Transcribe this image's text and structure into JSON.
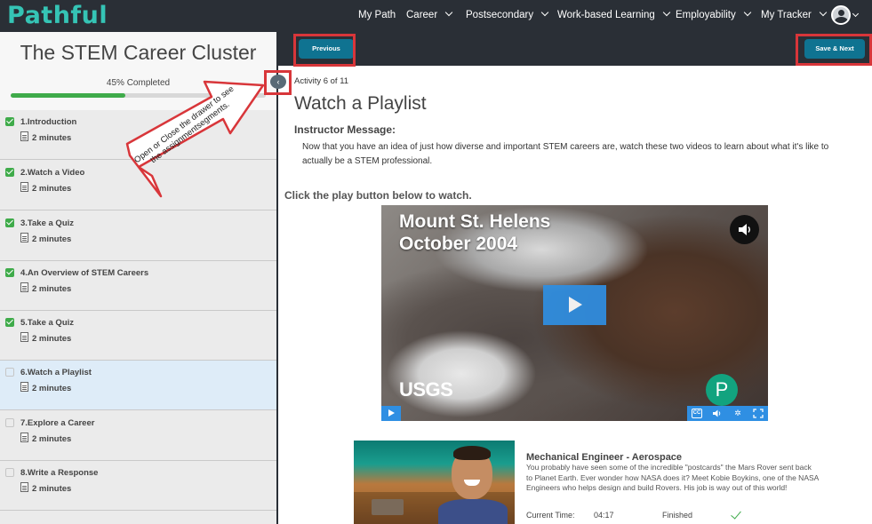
{
  "app": {
    "logo": "Pathful"
  },
  "nav": {
    "items": [
      {
        "label": "My Path",
        "dropdown": false
      },
      {
        "label": "Career",
        "dropdown": true
      },
      {
        "label": "Postsecondary",
        "dropdown": true
      },
      {
        "label": "Work-based Learning",
        "dropdown": true
      },
      {
        "label": "Employability",
        "dropdown": true
      },
      {
        "label": "My Tracker",
        "dropdown": true
      }
    ],
    "avatar_icon": "user-avatar-icon"
  },
  "sidebar": {
    "title": "The STEM Career Cluster",
    "progress_label": "45% Completed",
    "progress_value": 0.45,
    "activities": [
      {
        "name": "1.Introduction",
        "duration": "2 minutes",
        "completed": true,
        "current": false
      },
      {
        "name": "2.Watch a Video",
        "duration": "2 minutes",
        "completed": true,
        "current": false
      },
      {
        "name": "3.Take a Quiz",
        "duration": "2 minutes",
        "completed": true,
        "current": false
      },
      {
        "name": "4.An Overview of STEM Careers",
        "duration": "2 minutes",
        "completed": true,
        "current": false
      },
      {
        "name": "5.Take a Quiz",
        "duration": "2 minutes",
        "completed": true,
        "current": false
      },
      {
        "name": "6.Watch a Playlist",
        "duration": "2 minutes",
        "completed": false,
        "current": true
      },
      {
        "name": "7.Explore a Career",
        "duration": "2 minutes",
        "completed": false,
        "current": false
      },
      {
        "name": "8.Write a Response",
        "duration": "2 minutes",
        "completed": false,
        "current": false
      }
    ]
  },
  "toolbar": {
    "previous_label": "Previous",
    "save_next_label": "Save & Next"
  },
  "drawer_toggle": {
    "glyph": "‹"
  },
  "callout": {
    "text": "Open or Close the drawer to see the assignmentsegments."
  },
  "main": {
    "activity_label": "Activity 6 of 11",
    "title": "Watch a Playlist",
    "instructor_label": "Instructor Message:",
    "instructor_text": "Now that you have an idea of just how diverse and important STEM careers are, watch these two videos to learn about what it's like to actually be a STEM professional.",
    "click_label": "Click the play button below to watch."
  },
  "video1": {
    "overlay_line1": "Mount St. Helens",
    "overlay_line2": "October 2004",
    "watermark": "USGS",
    "badge": "P",
    "controls": [
      "cc-icon",
      "volume-icon",
      "settings-icon",
      "fullscreen-icon"
    ]
  },
  "video2": {
    "title": "Mechanical Engineer - Aerospace",
    "description": "You probably have seen some of the incredible \"postcards\" the Mars Rover sent back to Planet Earth. Ever wonder how NASA does it? Meet Kobie Boykins, one of the NASA Engineers who helps design and build Rovers. His job is way out of this world!",
    "current_time_label": "Current Time:",
    "current_time": "04:17",
    "status_label": "Finished"
  },
  "colors": {
    "nav_bg": "#2a2f36",
    "brand": "#35c4b5",
    "button": "#0f7391",
    "highlight": "#d8363a",
    "progress": "#3fab4a",
    "current_row": "#deecf8",
    "player_blue": "#2f8fe3"
  }
}
